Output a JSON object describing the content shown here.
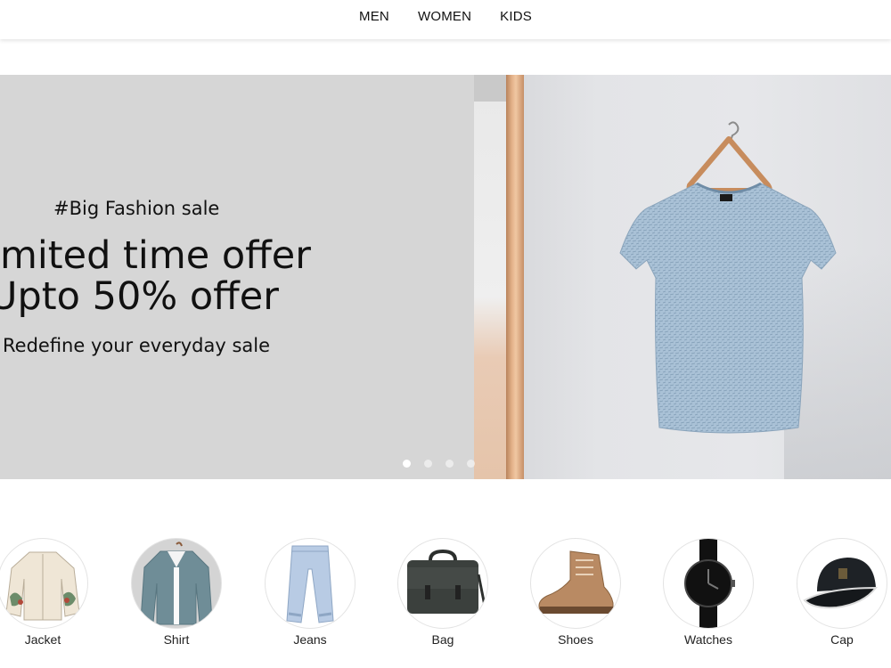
{
  "nav": {
    "items": [
      {
        "label": "MEN"
      },
      {
        "label": "WOMEN"
      },
      {
        "label": "KIDS"
      }
    ]
  },
  "hero": {
    "hashtag": "#Big Fashion sale",
    "headline_line1": "imited time offer",
    "headline_line2": "Upto 50% offer",
    "subline": "Redefine your everyday sale",
    "slides_total": 4,
    "active_slide": 1,
    "bg_color": "#d6d6d6"
  },
  "categories": [
    {
      "label": "Jacket",
      "icon": "jacket-icon"
    },
    {
      "label": "Shirt",
      "icon": "shirt-icon"
    },
    {
      "label": "Jeans",
      "icon": "jeans-icon"
    },
    {
      "label": "Bag",
      "icon": "bag-icon"
    },
    {
      "label": "Shoes",
      "icon": "shoes-icon"
    },
    {
      "label": "Watches",
      "icon": "watch-icon"
    },
    {
      "label": "Cap",
      "icon": "cap-icon"
    }
  ]
}
